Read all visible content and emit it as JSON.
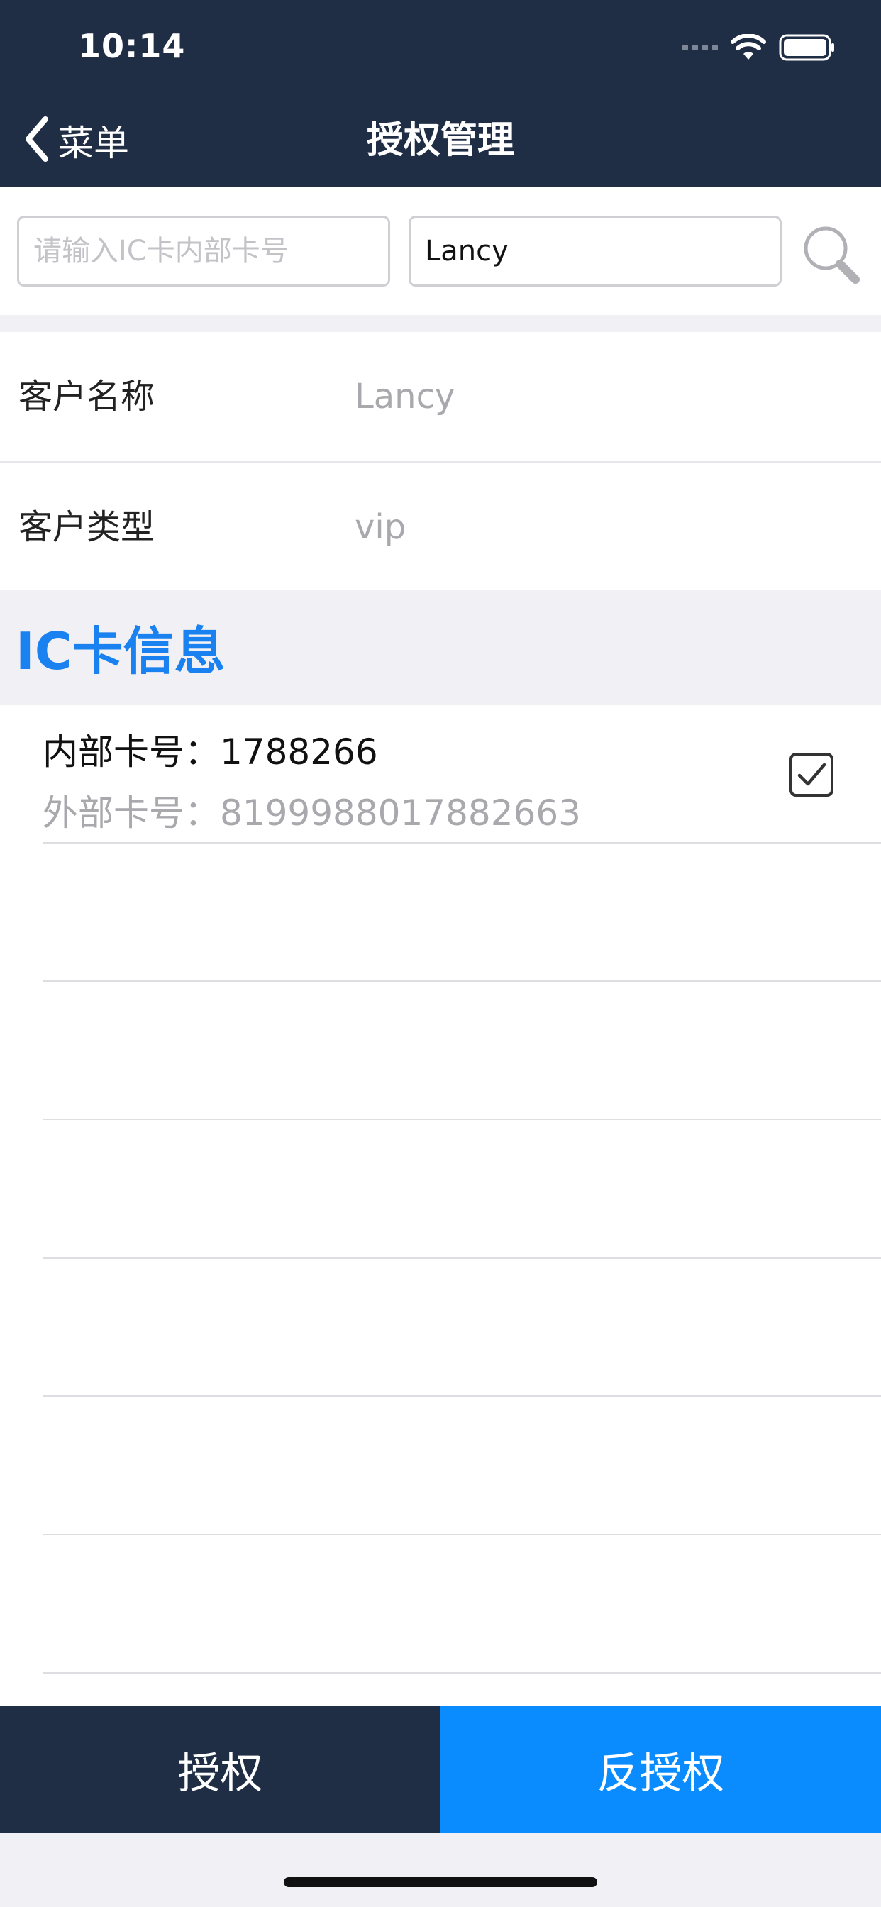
{
  "status_bar": {
    "time": "10:14"
  },
  "nav": {
    "back_label": "菜单",
    "title": "授权管理"
  },
  "search": {
    "ic_placeholder": "请输入IC卡内部卡号",
    "customer_value": "Lancy"
  },
  "customer_info": [
    {
      "label": "客户名称",
      "value": "Lancy"
    },
    {
      "label": "客户类型",
      "value": "vip"
    }
  ],
  "ic_section": {
    "title": "IC卡信息"
  },
  "cards": [
    {
      "internal": "内部卡号：1788266",
      "external": "外部卡号：8199988017882663",
      "checked": true
    }
  ],
  "bottom_actions": {
    "authorize": "授权",
    "unauthorize": "反授权"
  },
  "colors": {
    "nav_bg": "#1f2e45",
    "accent": "#1a82f0",
    "unauth_bg": "#0a8cff"
  },
  "icons": [
    "chevron-left-icon",
    "search-icon",
    "checkbox-checked-icon",
    "wifi-icon",
    "battery-icon"
  ]
}
